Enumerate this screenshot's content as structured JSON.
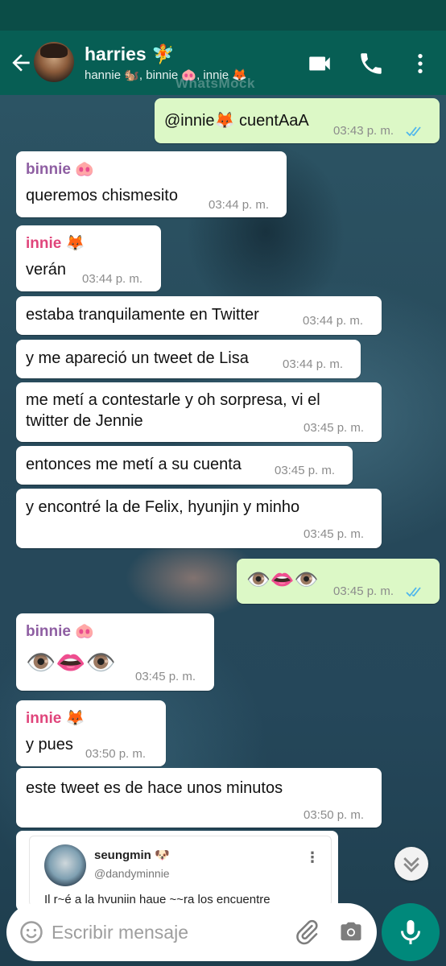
{
  "header": {
    "title": "harries 🧚",
    "subtitle": "hannie 🐿️, binnie 🐽, innie 🦊",
    "watermark": "WhatsMock"
  },
  "messages": [
    {
      "type": "out",
      "text": "@innie🦊 cuentAaA",
      "time": "03:43 p. m.",
      "status": "read"
    },
    {
      "type": "in",
      "sender": "binnie 🐽",
      "text": "queremos chismesito",
      "time": "03:44 p. m."
    },
    {
      "type": "in",
      "sender": "innie 🦊",
      "text": "verán",
      "time": "03:44 p. m."
    },
    {
      "type": "in",
      "text": "estaba tranquilamente en Twitter",
      "time": "03:44 p. m."
    },
    {
      "type": "in",
      "text": "y me apareció un tweet de Lisa",
      "time": "03:44 p. m."
    },
    {
      "type": "in",
      "text": "me metí a contestarle y oh sorpresa, vi el twitter de Jennie",
      "time": "03:45 p. m."
    },
    {
      "type": "in",
      "text": "entonces me metí a su cuenta",
      "time": "03:45 p. m."
    },
    {
      "type": "in",
      "text": "y encontré la de Felix, hyunjin y minho",
      "time": "03:45 p. m."
    },
    {
      "type": "out",
      "text": "👁️👄👁️",
      "time": "03:45 p. m.",
      "status": "read"
    },
    {
      "type": "in",
      "sender": "binnie 🐽",
      "text": "👁️👄👁️",
      "time": "03:45 p. m."
    },
    {
      "type": "in",
      "sender": "innie 🦊",
      "text": "y pues",
      "time": "03:50 p. m."
    },
    {
      "type": "in",
      "text": "este tweet es de hace unos minutos",
      "time": "03:50 p. m."
    }
  ],
  "tweet": {
    "name": "seungmin 🐶",
    "handle": "@dandyminnie",
    "text": "Il r~é a la hyunjin haue ~~ra los encuentre"
  },
  "input": {
    "placeholder": "Escribir mensaje"
  },
  "colors": {
    "header": "#075e54",
    "out_bubble": "#dcf8c6",
    "in_bubble": "#ffffff",
    "read_ticks": "#4fb6ec",
    "mic_button": "#00897b"
  },
  "icons": [
    "back-arrow-icon",
    "video-call-icon",
    "phone-icon",
    "more-vert-icon",
    "emoji-icon",
    "attach-icon",
    "camera-icon",
    "mic-icon",
    "chevron-down-icon"
  ]
}
